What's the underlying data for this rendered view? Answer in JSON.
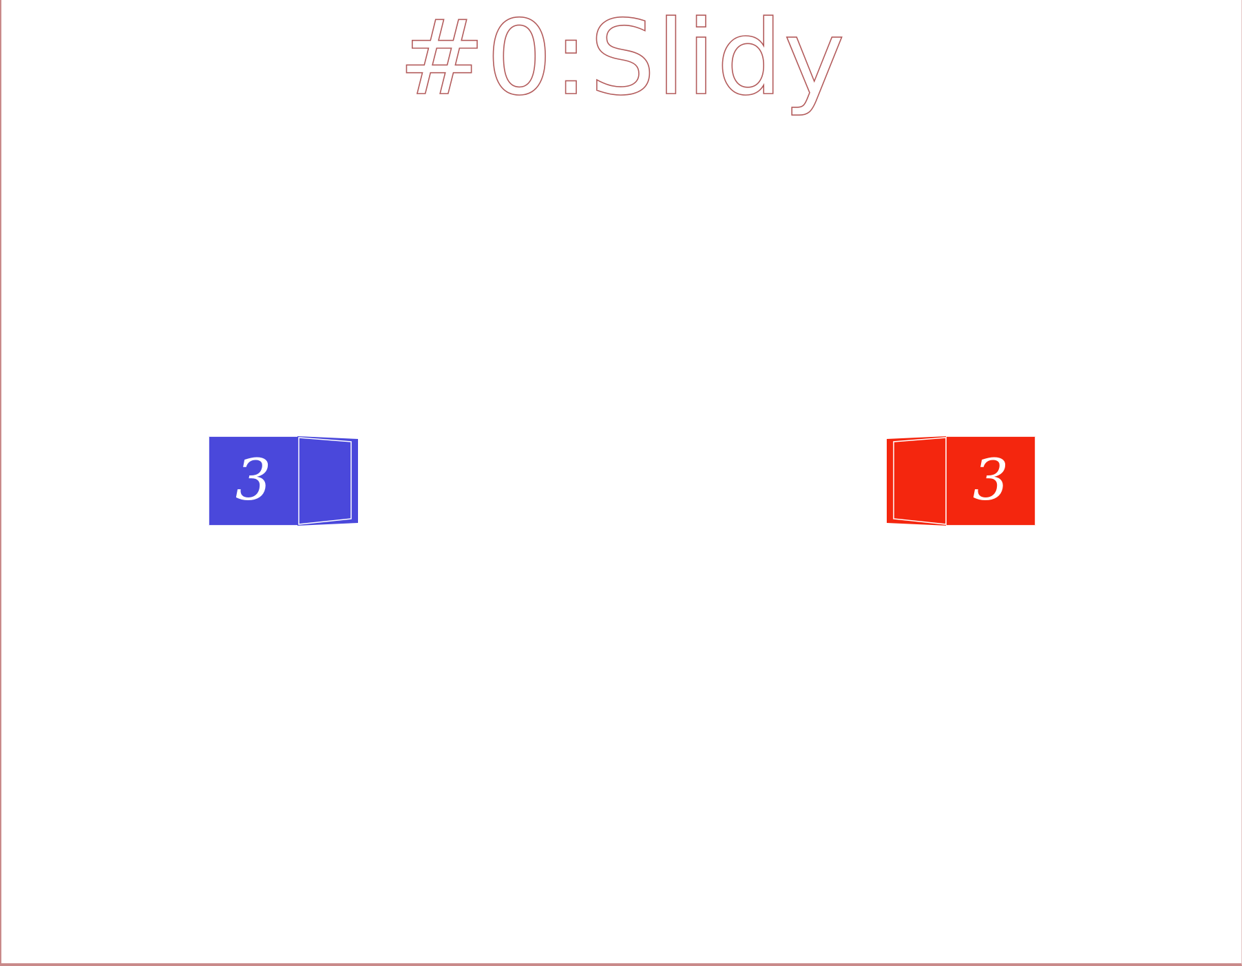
{
  "title": "#0:Slidy",
  "blocks": {
    "blue": {
      "number": "3",
      "color": "#4a48db"
    },
    "red": {
      "number": "3",
      "color": "#f4260e"
    }
  },
  "colors": {
    "background": "#ffffff",
    "title_outline": "#b25a5a"
  }
}
